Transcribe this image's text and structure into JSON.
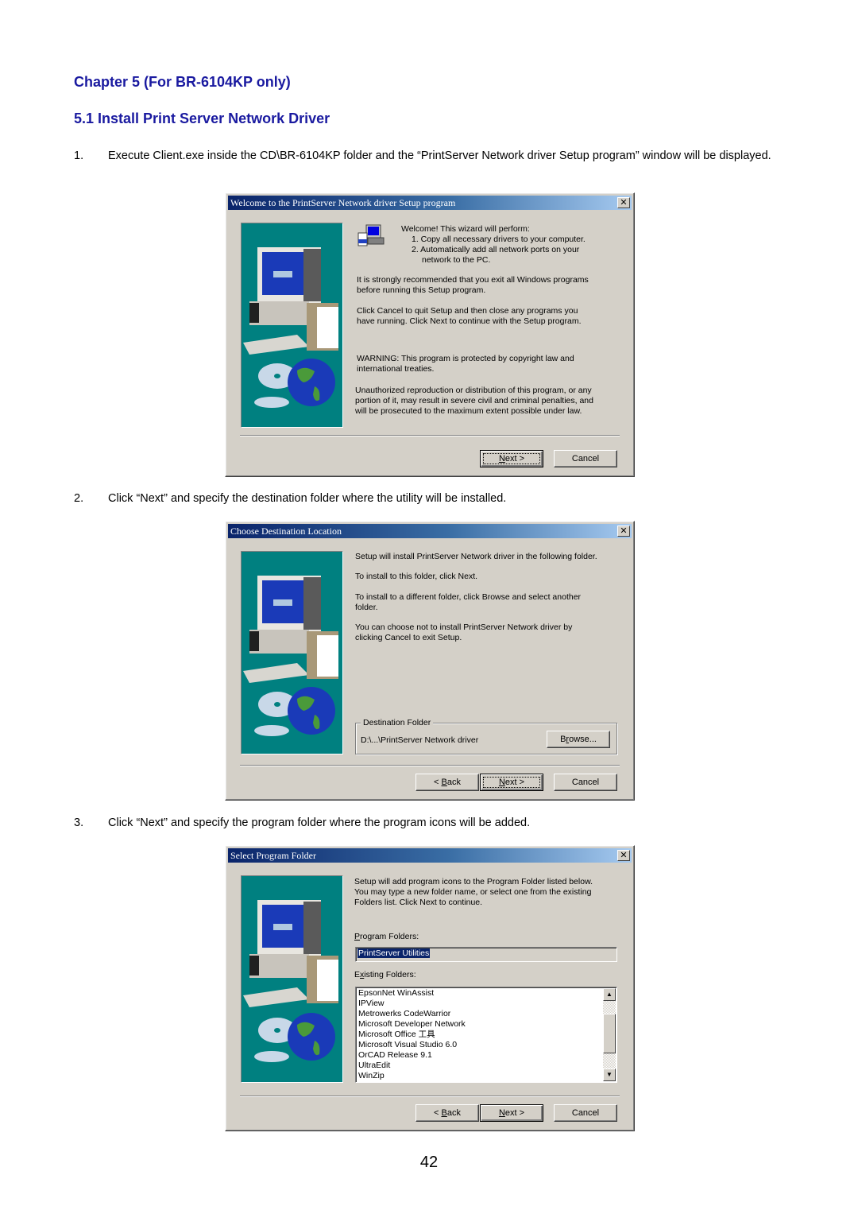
{
  "document": {
    "chapter_heading": "Chapter 5  (For BR-6104KP only)",
    "section_heading": "5.1 Install Print Server Network Driver",
    "page_number": "42",
    "steps": [
      {
        "num": "1.",
        "text": "Execute Client.exe inside the CD\\BR-6104KP folder and the “PrintServer Network driver Setup program” window will be displayed."
      },
      {
        "num": "2.",
        "text": "Click “Next” and specify the destination folder where the utility will be installed."
      },
      {
        "num": "3.",
        "text": "Click “Next” and specify the program folder where the program icons will be added."
      }
    ]
  },
  "dialogs": {
    "welcome": {
      "title": "Welcome to the PrintServer Network driver Setup program",
      "close_glyph": "✕",
      "intro": "Welcome! This wizard will perform:",
      "list": [
        "1. Copy all necessary drivers to your computer.",
        "2. Automatically add all network ports on your",
        "network to the PC."
      ],
      "para1": [
        "It is strongly recommended that you exit all Windows programs",
        "before running this Setup program."
      ],
      "para2": [
        "Click Cancel to quit Setup and then close any programs you",
        "have running.  Click Next to continue with the Setup program."
      ],
      "warning": [
        "WARNING: This program is protected by copyright law and",
        "international treaties."
      ],
      "legal": [
        "Unauthorized reproduction or distribution of this program, or any",
        "portion of it, may result in severe civil and criminal penalties, and",
        "will be prosecuted to the maximum extent possible under law."
      ],
      "buttons": {
        "next_u": "N",
        "next_rest": "ext >",
        "cancel": "Cancel"
      }
    },
    "destination": {
      "title": "Choose Destination Location",
      "close_glyph": "✕",
      "line1": "Setup will install PrintServer Network driver in the following folder.",
      "line2": "To install to this folder, click Next.",
      "line3": [
        "To install to a different folder, click Browse and select another",
        "folder."
      ],
      "line4": [
        "You can choose not to install PrintServer Network driver by",
        "clicking Cancel to exit Setup."
      ],
      "group_label": "Destination Folder",
      "path": "D:\\...\\PrintServer Network driver",
      "buttons": {
        "browse_pre": "B",
        "browse_u": "r",
        "browse_rest": "owse...",
        "back_pre": "< ",
        "back_u": "B",
        "back_rest": "ack",
        "next_u": "N",
        "next_rest": "ext >",
        "cancel": "Cancel"
      }
    },
    "program_folder": {
      "title": "Select Program Folder",
      "close_glyph": "✕",
      "intro": [
        "Setup will add program icons to the Program Folder listed below.",
        "You may type a new folder name, or select one from the existing",
        "Folders list.  Click Next to continue."
      ],
      "program_folders_label_u": "P",
      "program_folders_label_rest": "rogram Folders:",
      "program_folder_value": "PrintServer Utilities",
      "existing_label_pre": "E",
      "existing_label_u": "x",
      "existing_label_rest": "isting Folders:",
      "existing_folders": [
        "EpsonNet WinAssist",
        "IPView",
        "Metrowerks CodeWarrior",
        "Microsoft Developer Network",
        "Microsoft Office 工具",
        "Microsoft Visual Studio 6.0",
        "OrCAD Release 9.1",
        "UltraEdit",
        "WinZip"
      ],
      "scroll_up_glyph": "▲",
      "scroll_down_glyph": "▼",
      "buttons": {
        "back_pre": "< ",
        "back_u": "B",
        "back_rest": "ack",
        "next_u": "N",
        "next_rest": "ext >",
        "cancel": "Cancel"
      }
    }
  },
  "colors": {
    "heading": "#1a1aa0",
    "titlebar_start": "#0a246a",
    "titlebar_end": "#a6caf0",
    "dialog_face": "#d4d0c8",
    "illustration_bg": "#008080"
  }
}
